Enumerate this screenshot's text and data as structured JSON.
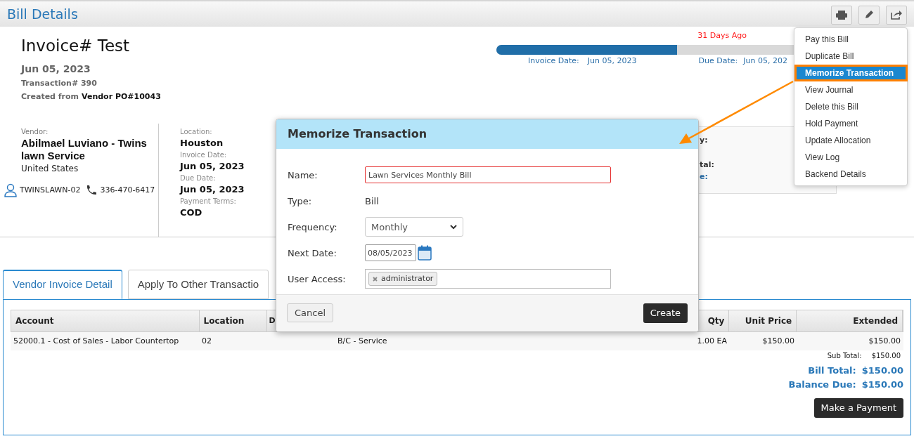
{
  "header": {
    "title": "Bill Details"
  },
  "invoice": {
    "title": "Invoice# Test",
    "date": "Jun 05, 2023",
    "transaction": "Transaction# 390",
    "created_label": "Created from",
    "created_value": "Vendor PO#10043"
  },
  "timeline": {
    "overdue": "31 Days Ago",
    "level": 0.5,
    "invoice_date_label": "Invoice Date:",
    "invoice_date": "Jun 05, 2023",
    "due_date_label": "Due Date:",
    "due_date": "Jun 05, 202"
  },
  "vendor": {
    "label": "Vendor:",
    "name": "Abilmael Luviano - Twins lawn Service",
    "country": "United States",
    "account": "TWINSLAWN-02",
    "phone": "336-470-6417"
  },
  "details": [
    {
      "label": "Location:",
      "value": "Houston"
    },
    {
      "label": "Invoice Date:",
      "value": "Jun 05, 2023"
    },
    {
      "label": "Due Date:",
      "value": "Jun 05, 2023"
    },
    {
      "label": "Payment Terms:",
      "value": "COD"
    }
  ],
  "summary_card": [
    {
      "kind": "label",
      "text": "y:"
    },
    {
      "kind": "label",
      "text": "tal:"
    },
    {
      "kind": "link",
      "text": "e:"
    }
  ],
  "menu": {
    "items": [
      {
        "label": "Pay this Bill",
        "selected": false
      },
      {
        "label": "Duplicate Bill",
        "selected": false
      },
      {
        "label": "Memorize Transaction",
        "selected": true
      },
      {
        "label": "View Journal",
        "selected": false
      },
      {
        "label": "Delete this Bill",
        "selected": false
      },
      {
        "label": "Hold Payment",
        "selected": false
      },
      {
        "label": "Update Allocation",
        "selected": false
      },
      {
        "label": "View Log",
        "selected": false
      },
      {
        "label": "Backend Details",
        "selected": false
      }
    ]
  },
  "dialog": {
    "title": "Memorize Transaction",
    "fields": [
      {
        "kind": "text",
        "label": "Name:",
        "value": "Lawn Services Monthly Bill",
        "invalid": true
      },
      {
        "kind": "static",
        "label": "Type:",
        "value": "Bill"
      },
      {
        "kind": "select",
        "label": "Frequency:",
        "value": "Monthly"
      },
      {
        "kind": "date",
        "label": "Next Date:",
        "value": "08/05/2023"
      },
      {
        "kind": "tags",
        "label": "User Access:",
        "tags": [
          "administrator"
        ]
      }
    ],
    "cancel": "Cancel",
    "create": "Create"
  },
  "tabs": [
    {
      "label": "Vendor Invoice Detail",
      "selected": true
    },
    {
      "label": "Apply To Other Transactio",
      "selected": false
    }
  ],
  "table": {
    "columns": [
      "Account",
      "Location",
      "D",
      "Qty",
      "Unit Price",
      "Extended"
    ],
    "rows": [
      {
        "account": "52000.1 - Cost of Sales - Labor Countertop",
        "location": "02",
        "column_4": "B/C - Service",
        "qty": "1.00 EA",
        "unit_price": "$150.00",
        "extended": "$150.00"
      }
    ]
  },
  "totals": {
    "subtotal_label": "Sub Total:",
    "subtotal": "$150.00",
    "bill_total_label": "Bill Total:",
    "bill_total": "$150.00",
    "balance_label": "Balance Due:",
    "balance": "$150.00"
  },
  "payment_button": "Make a Payment"
}
